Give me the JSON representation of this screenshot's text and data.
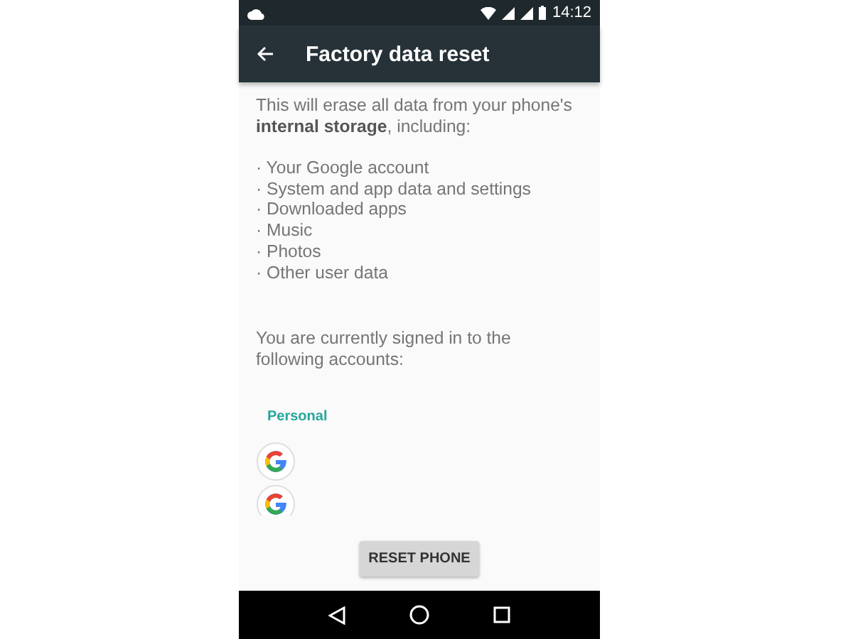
{
  "status_bar": {
    "time": "14:12"
  },
  "app_bar": {
    "title": "Factory data reset"
  },
  "intro": "This will erase all data from your phone's **internal storage**, including:",
  "erased_items": [
    "· Your Google account",
    "· System and app data and settings",
    "· Downloaded apps",
    "· Music",
    "· Photos",
    "· Other user data"
  ],
  "accounts_intro": "You are currently signed in to the following accounts:",
  "account_group": {
    "heading": "Personal",
    "accounts": [
      {
        "kind": "google"
      },
      {
        "kind": "google"
      }
    ]
  },
  "reset_button": "RESET PHONE"
}
